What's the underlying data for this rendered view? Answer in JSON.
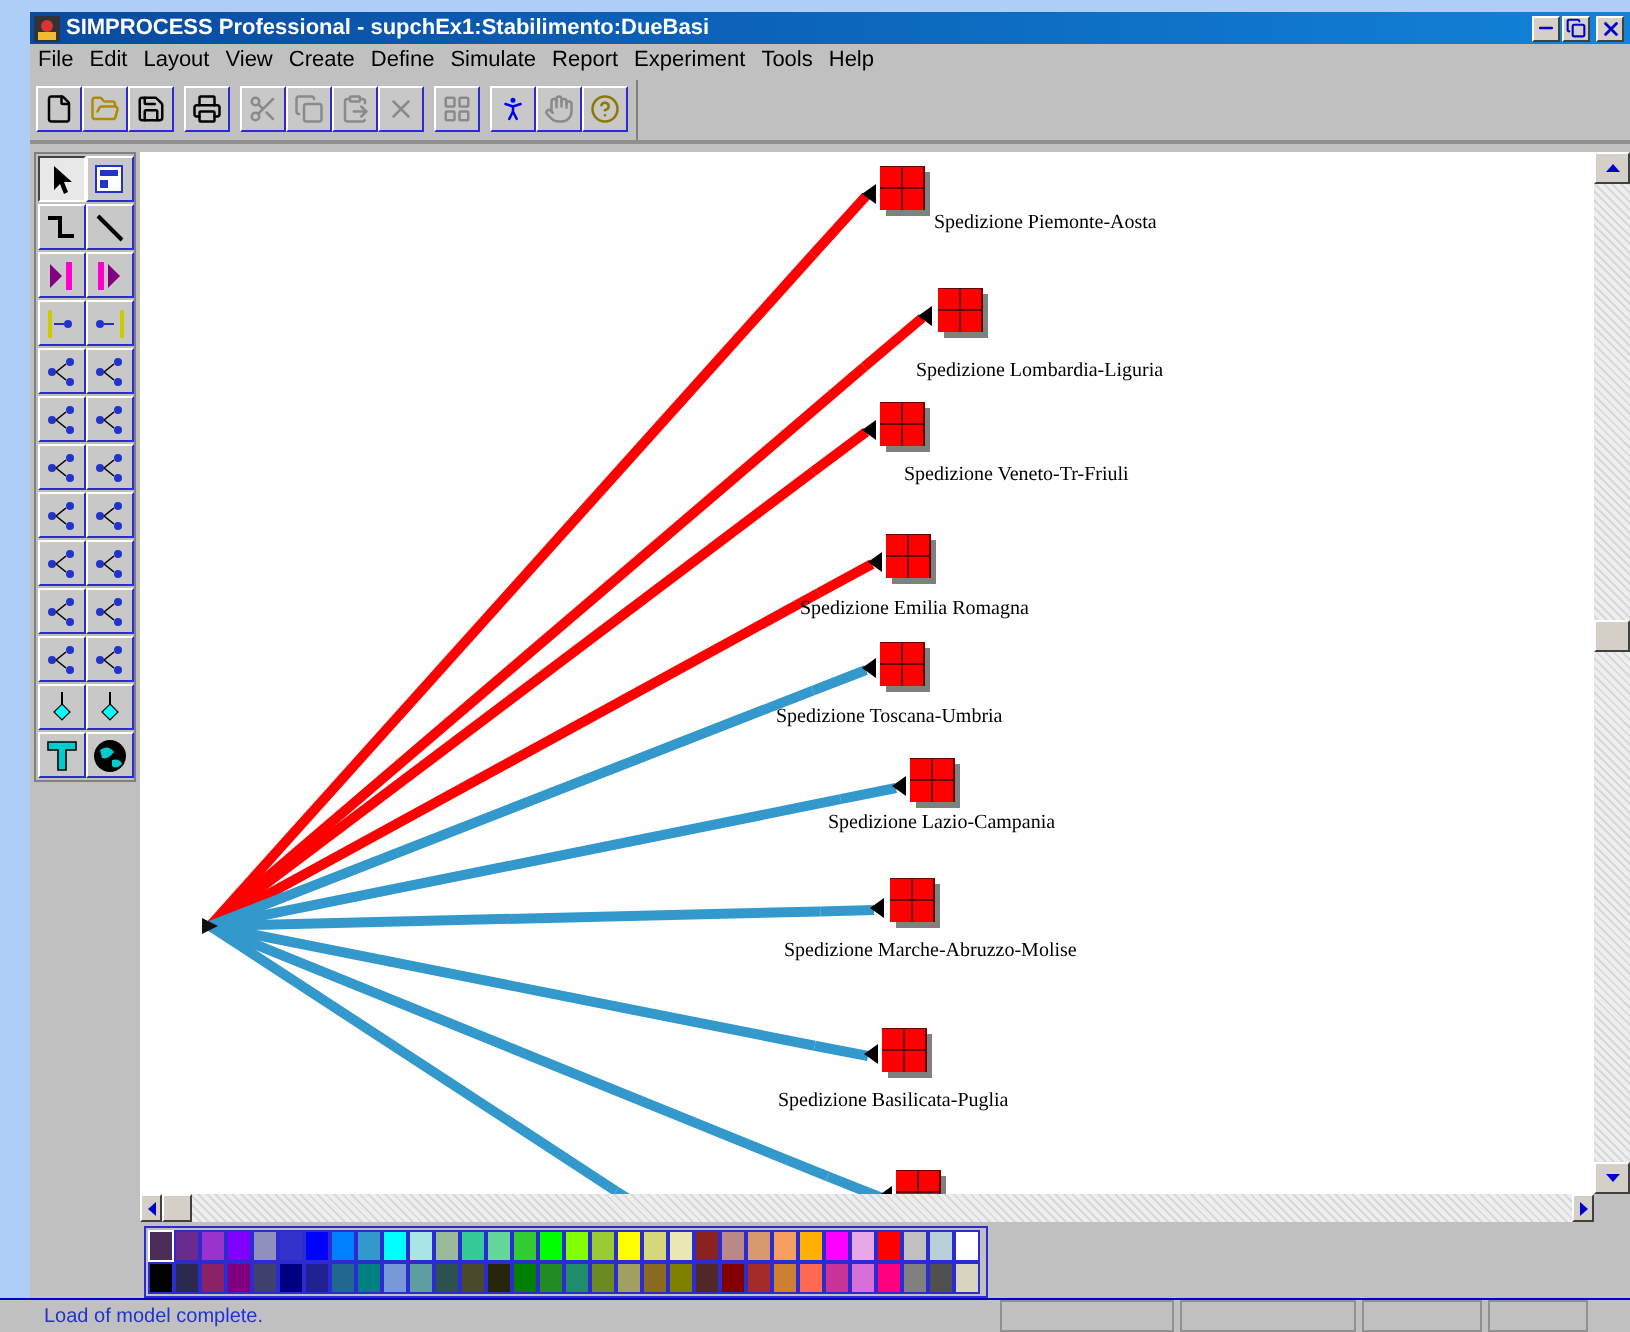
{
  "window": {
    "title": "SIMPROCESS Professional - supchEx1:Stabilimento:DueBasi"
  },
  "menu": [
    "File",
    "Edit",
    "Layout",
    "View",
    "Create",
    "Define",
    "Simulate",
    "Report",
    "Experiment",
    "Tools",
    "Help"
  ],
  "toolbar": [
    {
      "kind": "new",
      "disabled": false
    },
    {
      "kind": "open",
      "disabled": false
    },
    {
      "kind": "save",
      "disabled": false
    },
    {
      "kind": "print",
      "disabled": false
    },
    {
      "kind": "cut",
      "disabled": true
    },
    {
      "kind": "copy",
      "disabled": true
    },
    {
      "kind": "paste",
      "disabled": true
    },
    {
      "kind": "delete",
      "disabled": true
    },
    {
      "kind": "properties",
      "disabled": true
    },
    {
      "kind": "run",
      "disabled": false
    },
    {
      "kind": "stop",
      "disabled": true
    },
    {
      "kind": "help",
      "disabled": false
    }
  ],
  "tool_palette": [
    {
      "kind": "pointer",
      "selected": true
    },
    {
      "kind": "layout",
      "selected": false
    },
    {
      "kind": "curve",
      "selected": false
    },
    {
      "kind": "line",
      "selected": false
    },
    {
      "kind": "start",
      "selected": false
    },
    {
      "kind": "end",
      "selected": false
    },
    {
      "kind": "entry",
      "selected": false
    },
    {
      "kind": "exit",
      "selected": false
    },
    {
      "kind": "delay",
      "selected": false
    },
    {
      "kind": "branch",
      "selected": false
    },
    {
      "kind": "merge",
      "selected": false
    },
    {
      "kind": "join",
      "selected": false
    },
    {
      "kind": "cycle",
      "selected": false
    },
    {
      "kind": "cycle",
      "selected": false
    },
    {
      "kind": "split",
      "selected": false
    },
    {
      "kind": "combine",
      "selected": false
    },
    {
      "kind": "assign",
      "selected": false
    },
    {
      "kind": "split",
      "selected": false
    },
    {
      "kind": "gate",
      "selected": false
    },
    {
      "kind": "transform",
      "selected": false
    },
    {
      "kind": "sort",
      "selected": false
    },
    {
      "kind": "raise",
      "selected": false
    },
    {
      "kind": "diamond",
      "selected": false
    },
    {
      "kind": "diamond",
      "selected": false
    },
    {
      "kind": "text",
      "selected": false
    },
    {
      "kind": "globe",
      "selected": false
    }
  ],
  "diagram": {
    "connectors": [
      {
        "color": "#ff0000"
      },
      {
        "color": "#ff0000"
      },
      {
        "color": "#ff0000"
      },
      {
        "color": "#ff0000"
      },
      {
        "color": "#3399cc"
      },
      {
        "color": "#3399cc"
      },
      {
        "color": "#3399cc"
      },
      {
        "color": "#3399cc"
      },
      {
        "color": "#3399cc"
      },
      {
        "color": "#3399cc"
      }
    ],
    "node_labels": [
      "Spedizione Piemonte-Aosta",
      "Spedizione Lombardia-Liguria",
      "Spedizione Veneto-Tr-Friuli",
      "Spedizione Emilia Romagna",
      "Spedizione Toscana-Umbria",
      "Spedizione Lazio-Campania",
      "Spedizione Marche-Abruzzo-Molise",
      "Spedizione Basilicata-Puglia"
    ]
  },
  "palette": [
    {
      "color": "#4b2d5a",
      "selected": true
    },
    {
      "color": "#6a2a8e",
      "selected": false
    },
    {
      "color": "#9933cc",
      "selected": false
    },
    {
      "color": "#8000ff",
      "selected": false
    },
    {
      "color": "#9090c0",
      "selected": false
    },
    {
      "color": "#3333cc",
      "selected": false
    },
    {
      "color": "#0000ff",
      "selected": false
    },
    {
      "color": "#0080ff",
      "selected": false
    },
    {
      "color": "#3399cc",
      "selected": false
    },
    {
      "color": "#00ffff",
      "selected": false
    },
    {
      "color": "#aae5e5",
      "selected": false
    },
    {
      "color": "#99bb99",
      "selected": false
    },
    {
      "color": "#33cc99",
      "selected": false
    },
    {
      "color": "#66d699",
      "selected": false
    },
    {
      "color": "#33cc33",
      "selected": false
    },
    {
      "color": "#00ff00",
      "selected": false
    },
    {
      "color": "#80ff00",
      "selected": false
    },
    {
      "color": "#99cc33",
      "selected": false
    },
    {
      "color": "#ffff00",
      "selected": false
    },
    {
      "color": "#d6d67a",
      "selected": false
    },
    {
      "color": "#e8e8b0",
      "selected": false
    },
    {
      "color": "#8b2222",
      "selected": false
    },
    {
      "color": "#bb8888",
      "selected": false
    },
    {
      "color": "#d69970",
      "selected": false
    },
    {
      "color": "#f5a060",
      "selected": false
    },
    {
      "color": "#ffb000",
      "selected": false
    },
    {
      "color": "#ff00ff",
      "selected": false
    },
    {
      "color": "#e8a8e8",
      "selected": false
    },
    {
      "color": "#ff0000",
      "selected": false
    },
    {
      "color": "#c0c0c0",
      "selected": false
    },
    {
      "color": "#b8d0d8",
      "selected": false
    },
    {
      "color": "#ffffff",
      "selected": false
    },
    {
      "color": "#000000",
      "selected": false
    },
    {
      "color": "#2a2a50",
      "selected": false
    },
    {
      "color": "#8b2266",
      "selected": false
    },
    {
      "color": "#800080",
      "selected": false
    },
    {
      "color": "#404070",
      "selected": false
    },
    {
      "color": "#000080",
      "selected": false
    },
    {
      "color": "#202090",
      "selected": false
    },
    {
      "color": "#206890",
      "selected": false
    },
    {
      "color": "#008080",
      "selected": false
    },
    {
      "color": "#7799d6",
      "selected": false
    },
    {
      "color": "#5f9ea0",
      "selected": false
    },
    {
      "color": "#2f5050",
      "selected": false
    },
    {
      "color": "#4a4a2a",
      "selected": false
    },
    {
      "color": "#26260a",
      "selected": false
    },
    {
      "color": "#008000",
      "selected": false
    },
    {
      "color": "#228b22",
      "selected": false
    },
    {
      "color": "#228b6b",
      "selected": false
    },
    {
      "color": "#6b8b22",
      "selected": false
    },
    {
      "color": "#a0a060",
      "selected": false
    },
    {
      "color": "#8b6b22",
      "selected": false
    },
    {
      "color": "#808000",
      "selected": false
    },
    {
      "color": "#502828",
      "selected": false
    },
    {
      "color": "#800000",
      "selected": false
    },
    {
      "color": "#a52a2a",
      "selected": false
    },
    {
      "color": "#cd7f32",
      "selected": false
    },
    {
      "color": "#ff6a50",
      "selected": false
    },
    {
      "color": "#cc3399",
      "selected": false
    },
    {
      "color": "#d670d6",
      "selected": false
    },
    {
      "color": "#ff0080",
      "selected": false
    },
    {
      "color": "#808080",
      "selected": false
    },
    {
      "color": "#505050",
      "selected": false
    },
    {
      "color": "#d8d4c0",
      "selected": false
    }
  ],
  "status_bar": {
    "message": "Load of model complete."
  }
}
